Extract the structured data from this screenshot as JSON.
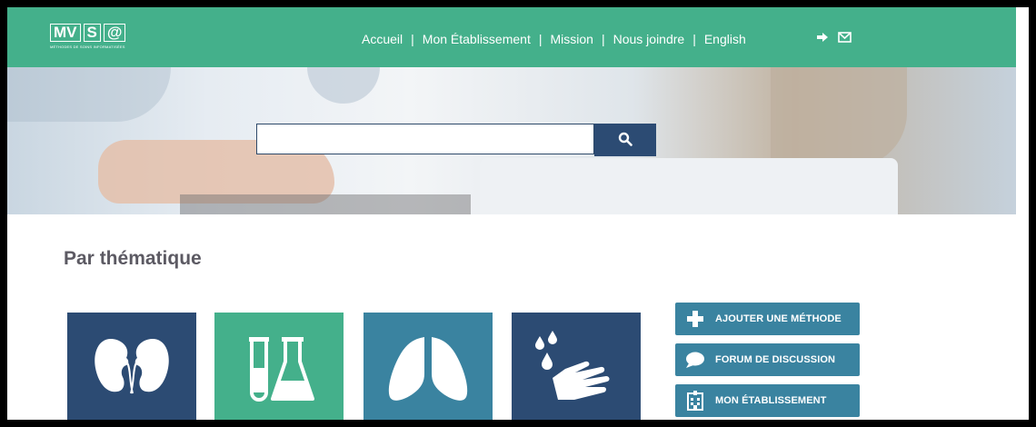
{
  "header": {
    "logo_mark": [
      "MV",
      "S",
      "@"
    ],
    "logo_subtitle": "MÉTHODES DE SOINS INFORMATISÉES",
    "nav": [
      {
        "label": "Accueil"
      },
      {
        "label": "Mon Établissement"
      },
      {
        "label": "Mission"
      },
      {
        "label": "Nous joindre"
      },
      {
        "label": "English"
      }
    ],
    "separator": "|",
    "icons": [
      "sign-in-icon",
      "envelope-icon"
    ]
  },
  "search": {
    "value": "",
    "placeholder": "",
    "icon": "search-icon"
  },
  "section": {
    "title": "Par thématique"
  },
  "tiles": [
    {
      "icon": "kidneys-icon",
      "color": "#2c4b73"
    },
    {
      "icon": "lab-flask-icon",
      "color": "#44b08b"
    },
    {
      "icon": "lungs-icon",
      "color": "#3a83a0"
    },
    {
      "icon": "hand-washing-icon",
      "color": "#2c4b73"
    }
  ],
  "actions": [
    {
      "label": "AJOUTER UNE MÉTHODE",
      "icon": "plus-icon"
    },
    {
      "label": "FORUM DE DISCUSSION",
      "icon": "chat-bubble-icon"
    },
    {
      "label": "MON ÉTABLISSEMENT",
      "icon": "hospital-icon"
    }
  ],
  "colors": {
    "header": "#44b08b",
    "navy": "#2c4b73",
    "teal": "#3a83a0",
    "green": "#44b08b",
    "title": "#5c5a63"
  }
}
